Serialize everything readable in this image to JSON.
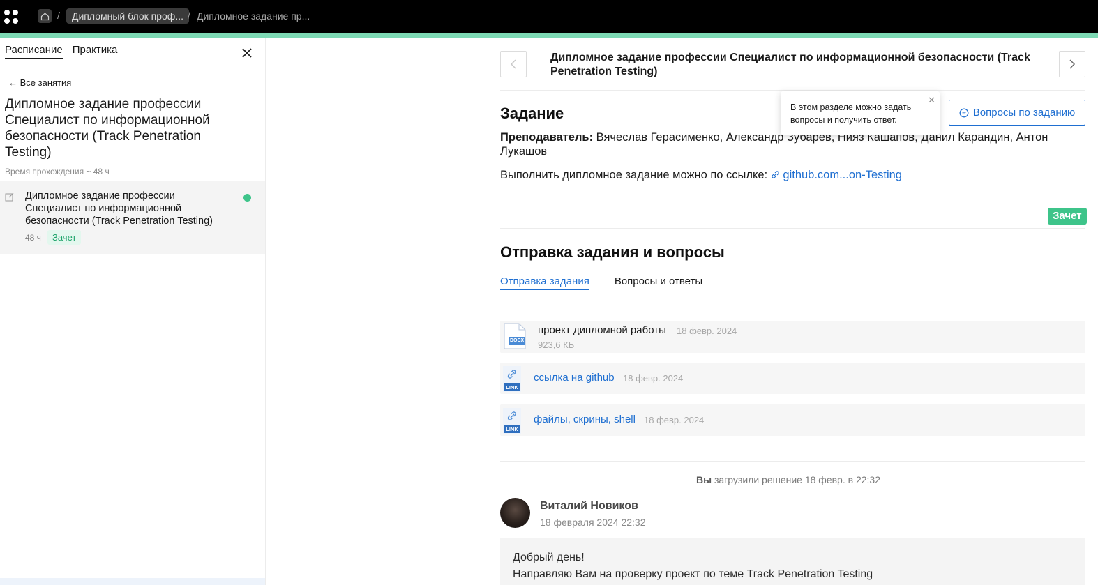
{
  "topbar": {
    "breadcrumb_course": "Дипломный блок проф...",
    "breadcrumb_separator": "/",
    "breadcrumb_current": "Дипломное задание пр..."
  },
  "sidebar": {
    "tabs": [
      {
        "label": "Расписание",
        "active": true
      },
      {
        "label": "Практика",
        "active": false
      }
    ],
    "back_label": "Все занятия",
    "title": "Дипломное задание профессии Специалист по информационной безопасности (Track Penetration Testing)",
    "duration": "Время прохождения ~ 48 ч",
    "lesson": {
      "title": "Дипломное задание профессии Специалист по информационной безопасности (Track Penetration Testing)",
      "hours": "48 ч",
      "status": "Зачет",
      "status_color": "#3ec48a"
    }
  },
  "main": {
    "title": "Дипломное задание профессии Специалист по информационной безопасности (Track Penetration Testing)",
    "task_heading": "Задание",
    "teacher_label": "Преподаватель:",
    "teacher_names": "Вячеслав Герасименко, Александр Зубарев, Нияз Кашапов, Данил Карандин, Антон Лукашов",
    "task_text": "Выполнить дипломное задание можно по ссылке:",
    "task_link": "github.com...on-Testing",
    "tooltip": "В этом разделе можно задать вопросы и получить ответ.",
    "questions_button": "Вопросы по заданию",
    "grade_badge": "Зачет",
    "submission_heading": "Отправка задания и вопросы",
    "sub_tabs": [
      {
        "label": "Отправка задания",
        "active": true
      },
      {
        "label": "Вопросы и ответы",
        "active": false
      }
    ],
    "files": [
      {
        "type": "DOCX",
        "name": "проект дипломной работы",
        "date": "18 февр. 2024",
        "size": "923,6 КБ"
      },
      {
        "type": "LINK",
        "name": "ссылка на github",
        "date": "18 февр. 2024"
      },
      {
        "type": "LINK",
        "name": "файлы, скрины, shell",
        "date": "18 февр. 2024"
      }
    ],
    "upload_actor": "Вы",
    "upload_text": "загрузили решение 18 февр. в 22:32",
    "comment": {
      "author": "Виталий Новиков",
      "date": "18 февраля 2024 22:32",
      "line1": "Добрый день!",
      "line2": "Направляю Вам на проверку проект по теме Track Penetration Testing"
    }
  },
  "colors": {
    "accent_green": "#7dd9b4",
    "link_blue": "#1f6fd1",
    "success": "#3ec48a"
  }
}
